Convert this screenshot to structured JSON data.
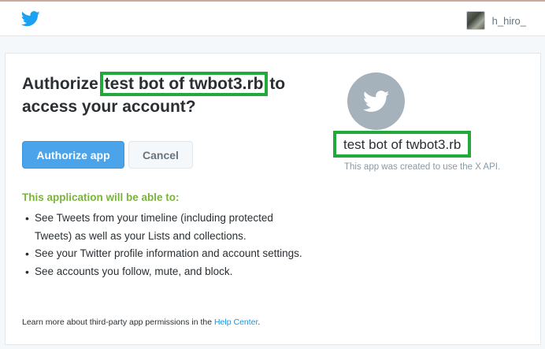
{
  "header": {
    "logo_icon": "twitter-bird-icon",
    "username": "h_hiro_",
    "brand_color": "#1da1f2"
  },
  "authorize": {
    "title_prefix": "Authorize ",
    "app_name": "test bot of twbot3.rb",
    "title_suffix": " to access your account?",
    "authorize_label": "Authorize app",
    "cancel_label": "Cancel"
  },
  "permissions": {
    "heading": "This application will be able to:",
    "items": [
      "See Tweets from your timeline (including protected Tweets) as well as your Lists and collections.",
      "See your Twitter profile information and account settings.",
      "See accounts you follow, mute, and block."
    ]
  },
  "footer": {
    "prefix": "Learn more about third-party app permissions in the ",
    "link": "Help Center",
    "suffix": "."
  },
  "app": {
    "name": "test bot of twbot3.rb",
    "note": "This app was created to use the X API.",
    "avatar_icon": "twitter-bird-icon"
  },
  "colors": {
    "highlight": "#21a93a",
    "button": "#4ba3ea",
    "permission_heading": "#7bb33e"
  }
}
